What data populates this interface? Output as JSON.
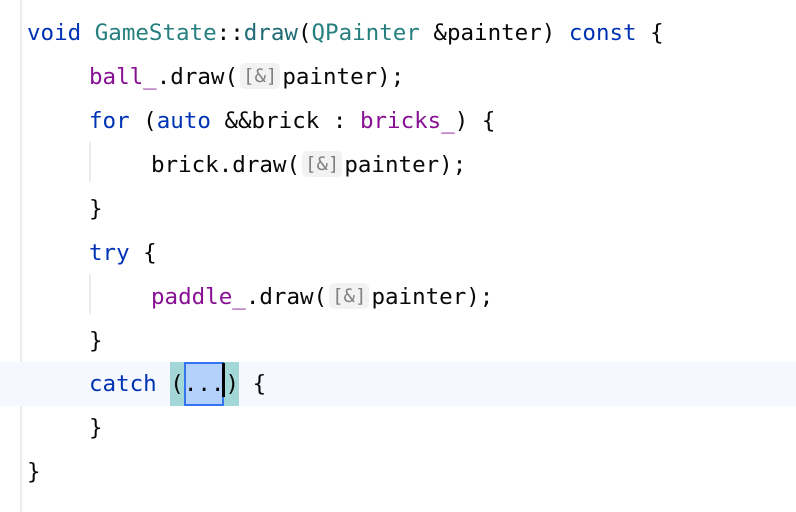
{
  "editor": {
    "language": "C++",
    "lines": [
      {
        "tokens": [
          {
            "text": "void",
            "kind": "keyword"
          },
          {
            "text": " ",
            "kind": "plain"
          },
          {
            "text": "GameState",
            "kind": "type"
          },
          {
            "text": "::",
            "kind": "plain"
          },
          {
            "text": "draw",
            "kind": "function"
          },
          {
            "text": "(",
            "kind": "plain"
          },
          {
            "text": "QPainter",
            "kind": "type"
          },
          {
            "text": " &painter) ",
            "kind": "plain"
          },
          {
            "text": "const",
            "kind": "keyword"
          },
          {
            "text": " {",
            "kind": "plain"
          }
        ]
      },
      {
        "tokens": [
          {
            "text": "ball_",
            "kind": "field"
          },
          {
            "text": ".draw(",
            "kind": "plain"
          },
          {
            "text": "[&]",
            "kind": "hint"
          },
          {
            "text": "painter);",
            "kind": "plain"
          }
        ]
      },
      {
        "tokens": [
          {
            "text": "for",
            "kind": "keyword"
          },
          {
            "text": " (",
            "kind": "plain"
          },
          {
            "text": "auto",
            "kind": "keyword"
          },
          {
            "text": " &&brick : ",
            "kind": "plain"
          },
          {
            "text": "bricks_",
            "kind": "field"
          },
          {
            "text": ") {",
            "kind": "plain"
          }
        ]
      },
      {
        "tokens": [
          {
            "text": "brick.draw(",
            "kind": "plain"
          },
          {
            "text": "[&]",
            "kind": "hint"
          },
          {
            "text": "painter);",
            "kind": "plain"
          }
        ]
      },
      {
        "tokens": [
          {
            "text": "}",
            "kind": "plain"
          }
        ]
      },
      {
        "tokens": [
          {
            "text": "try",
            "kind": "keyword"
          },
          {
            "text": " {",
            "kind": "plain"
          }
        ]
      },
      {
        "tokens": [
          {
            "text": "paddle_",
            "kind": "field"
          },
          {
            "text": ".draw(",
            "kind": "plain"
          },
          {
            "text": "[&]",
            "kind": "hint"
          },
          {
            "text": "painter);",
            "kind": "plain"
          }
        ]
      },
      {
        "tokens": [
          {
            "text": "}",
            "kind": "plain"
          }
        ]
      },
      {
        "catch_line": {
          "keyword": "catch",
          "open_paren": "(",
          "selected_text": "...",
          "close_paren": ")",
          "brace": "{"
        }
      },
      {
        "tokens": [
          {
            "text": "}",
            "kind": "plain"
          }
        ]
      },
      {
        "tokens": [
          {
            "text": "}",
            "kind": "plain"
          }
        ]
      }
    ],
    "parameter_hint": "[&]",
    "colors": {
      "keyword": "#0033b3",
      "type": "#267f7f",
      "function": "#1f6b75",
      "field": "#871094",
      "plain": "#080808",
      "hint_text": "#808080",
      "hint_bg": "#f2f2f2",
      "current_line_bg": "#f5f8fe",
      "paren_match_bg": "#a3d6d6",
      "selection_bg": "#b3d1fa",
      "selection_border": "#3574f0"
    }
  }
}
